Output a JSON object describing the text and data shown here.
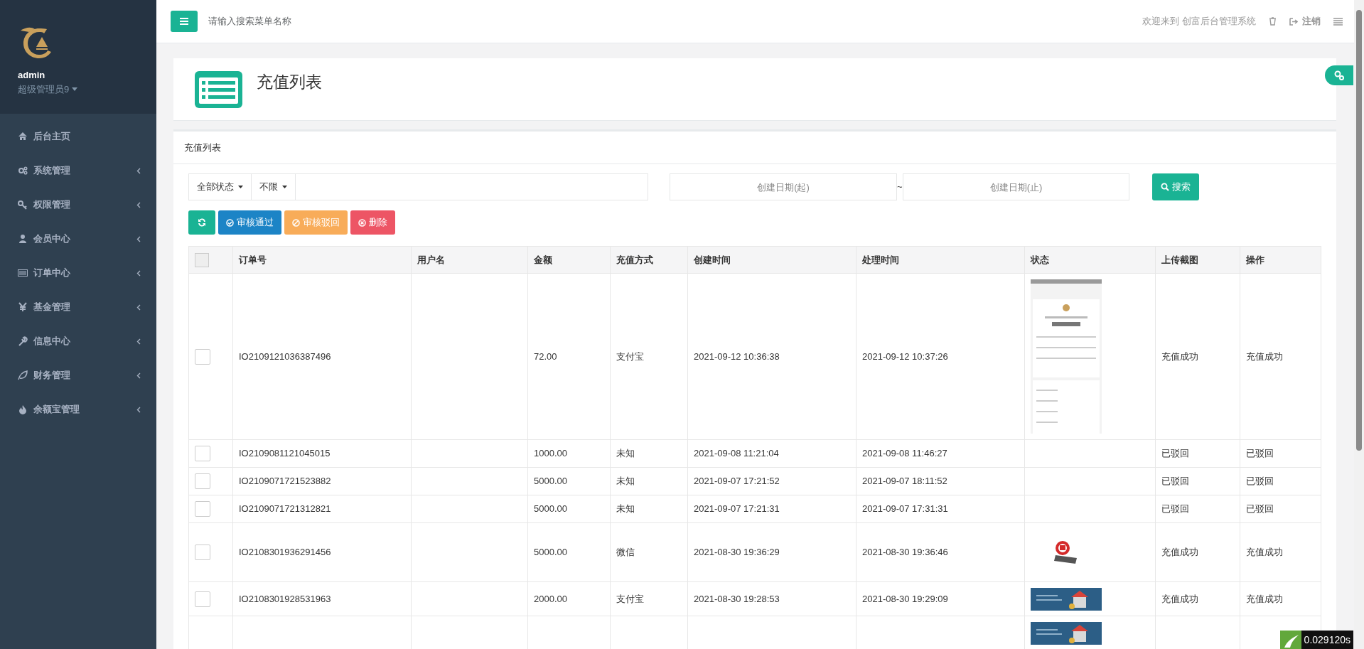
{
  "sidebar": {
    "user": {
      "name": "admin",
      "role": "超级管理员9"
    },
    "items": [
      {
        "label": "后台主页",
        "has_submenu": false
      },
      {
        "label": "系统管理",
        "has_submenu": true
      },
      {
        "label": "权限管理",
        "has_submenu": true
      },
      {
        "label": "会员中心",
        "has_submenu": true
      },
      {
        "label": "订单中心",
        "has_submenu": true
      },
      {
        "label": "基金管理",
        "has_submenu": true
      },
      {
        "label": "信息中心",
        "has_submenu": true
      },
      {
        "label": "财务管理",
        "has_submenu": true
      },
      {
        "label": "余额宝管理",
        "has_submenu": true
      }
    ]
  },
  "topbar": {
    "search_placeholder": "请输入搜索菜单名称",
    "welcome": "欢迎来到 创富后台管理系统",
    "logout": "注销"
  },
  "page_title": "充值列表",
  "panel": {
    "title": "充值列表",
    "filters": {
      "status": "全部状态",
      "range": "不限",
      "date_from_placeholder": "创建日期(起)",
      "separator": "~",
      "date_to_placeholder": "创建日期(止)",
      "search_button": "搜索"
    },
    "actions": [
      {
        "kind": "refresh"
      },
      {
        "kind": "approve",
        "label": "审核通过"
      },
      {
        "kind": "reject",
        "label": "审核驳回"
      },
      {
        "kind": "delete",
        "label": "删除"
      }
    ],
    "table": {
      "all_checked": false,
      "columns": [
        "订单号",
        "用户名",
        "金额",
        "充值方式",
        "创建时间",
        "处理时间",
        "状态",
        "上传截图",
        "操作"
      ],
      "rows": [
        {
          "checked": false,
          "cells": [
            "IO2109121036387496",
            "",
            "72.00",
            "支付宝",
            "2021-09-12 10:36:38",
            "2021-09-12 10:37:26",
            {
              "kind": "picture"
            },
            "充值成功",
            "充值成功"
          ]
        },
        {
          "checked": false,
          "cells": [
            "IO2109081121045015",
            "",
            "1000.00",
            "未知",
            "2021-09-08 11:21:04",
            "2021-09-08 11:46:27",
            "",
            "已驳回",
            "已驳回"
          ]
        },
        {
          "checked": false,
          "cells": [
            "IO2109071721523882",
            "",
            "5000.00",
            "未知",
            "2021-09-07 17:21:52",
            "2021-09-07 18:11:52",
            "",
            "已驳回",
            "已驳回"
          ]
        },
        {
          "checked": false,
          "cells": [
            "IO2109071721312821",
            "",
            "5000.00",
            "未知",
            "2021-09-07 17:21:31",
            "2021-09-07 17:31:31",
            "",
            "已驳回",
            "已驳回"
          ]
        },
        {
          "checked": false,
          "cells": [
            "IO2108301936291456",
            "",
            "5000.00",
            "微信",
            "2021-08-30 19:36:29",
            "2021-08-30 19:36:46",
            {
              "kind": "picture"
            },
            "充值成功",
            "充值成功"
          ]
        },
        {
          "checked": false,
          "cells": [
            "IO2108301928531963",
            "",
            "2000.00",
            "支付宝",
            "2021-08-30 19:28:53",
            "2021-08-30 19:29:09",
            {
              "kind": "picture"
            },
            "充值成功",
            "充值成功"
          ]
        },
        {
          "cells": [
            "",
            "",
            "",
            "",
            "",
            "",
            {
              "kind": "picture"
            },
            "",
            ""
          ]
        }
      ]
    }
  },
  "debug_timer": "0.029120s"
}
